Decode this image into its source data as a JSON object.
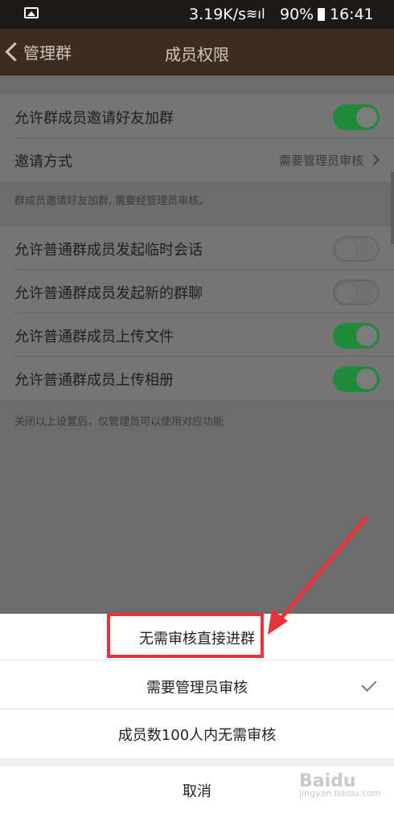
{
  "status_bar": {
    "speed": "3.19K/s",
    "battery": "90%",
    "time": "16:41"
  },
  "nav": {
    "back_label": "管理群",
    "title": "成员权限"
  },
  "settings": {
    "invite_friends": {
      "label": "允许群成员邀请好友加群",
      "enabled": true
    },
    "invite_method": {
      "label": "邀请方式",
      "value": "需要管理员审核"
    },
    "invite_note": "群成员邀请好友加群, 需要经管理员审核。",
    "temp_chat": {
      "label": "允许普通群成员发起临时会话",
      "enabled": false
    },
    "new_group_chat": {
      "label": "允许普通群成员发起新的群聊",
      "enabled": false
    },
    "upload_files": {
      "label": "允许普通群成员上传文件",
      "enabled": true
    },
    "upload_album": {
      "label": "允许普通群成员上传相册",
      "enabled": true
    },
    "footer_note": "关闭以上设置后，仅管理员可以使用对应功能"
  },
  "sheet": {
    "options": [
      {
        "label": "无需审核直接进群",
        "selected": false
      },
      {
        "label": "需要管理员审核",
        "selected": true
      },
      {
        "label": "成员数100人内无需审核",
        "selected": false
      }
    ],
    "cancel_label": "取消"
  },
  "watermark": {
    "brand": "Baidu",
    "sub": "jingyan.baidu.com"
  },
  "colors": {
    "accent_green": "#1f8a3a",
    "nav_bg": "#3c2d20",
    "highlight_red": "#e8323a"
  }
}
